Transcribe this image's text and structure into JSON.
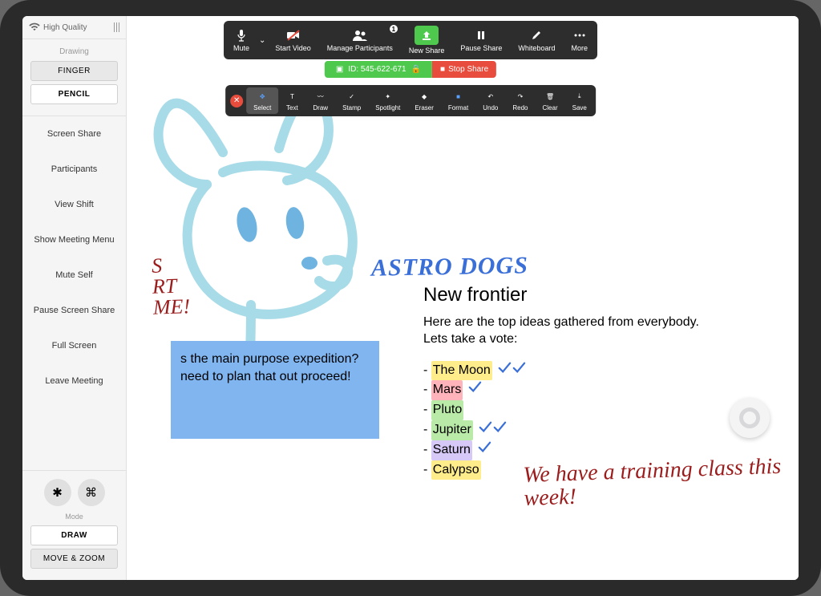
{
  "sidebar": {
    "quality": "High Quality",
    "drawing_label": "Drawing",
    "finger": "FINGER",
    "pencil": "PENCIL",
    "items": [
      "Screen Share",
      "Participants",
      "View Shift",
      "Show Meeting Menu",
      "Mute Self",
      "Pause Screen Share",
      "Full Screen",
      "Leave Meeting"
    ],
    "mode_label": "Mode",
    "draw": "DRAW",
    "move_zoom": "MOVE & ZOOM"
  },
  "zoom": {
    "mute": "Mute",
    "start_video": "Start Video",
    "manage": "Manage Participants",
    "manage_count": "1",
    "new_share": "New Share",
    "pause_share": "Pause Share",
    "whiteboard": "Whiteboard",
    "more": "More"
  },
  "share": {
    "id_label": "ID: 545-622-671",
    "stop": "Stop Share"
  },
  "anno": {
    "select": "Select",
    "text": "Text",
    "draw": "Draw",
    "stamp": "Stamp",
    "spotlight": "Spotlight",
    "eraser": "Eraser",
    "format": "Format",
    "undo": "Undo",
    "redo": "Redo",
    "clear": "Clear",
    "save": "Save"
  },
  "content": {
    "hw_title": "ASTRO DOGS",
    "heading": "New frontier",
    "intro": "Here are the top ideas gathered from everybody. Lets take a vote:",
    "options": [
      {
        "name": "The Moon",
        "hl": "hl-yellow",
        "checks": 2
      },
      {
        "name": "Mars",
        "hl": "hl-pink",
        "checks": 1
      },
      {
        "name": "Pluto",
        "hl": "hl-green",
        "checks": 0
      },
      {
        "name": "Jupiter",
        "hl": "hl-green",
        "checks": 2
      },
      {
        "name": "Saturn",
        "hl": "hl-purple",
        "checks": 1
      },
      {
        "name": "Calypso",
        "hl": "hl-yellow",
        "checks": 0
      }
    ],
    "blue_box": "s the main purpose expedition?  need to plan that out proceed!",
    "red1": "S\nRT\nME!",
    "red2": "We have a training class this week!"
  }
}
